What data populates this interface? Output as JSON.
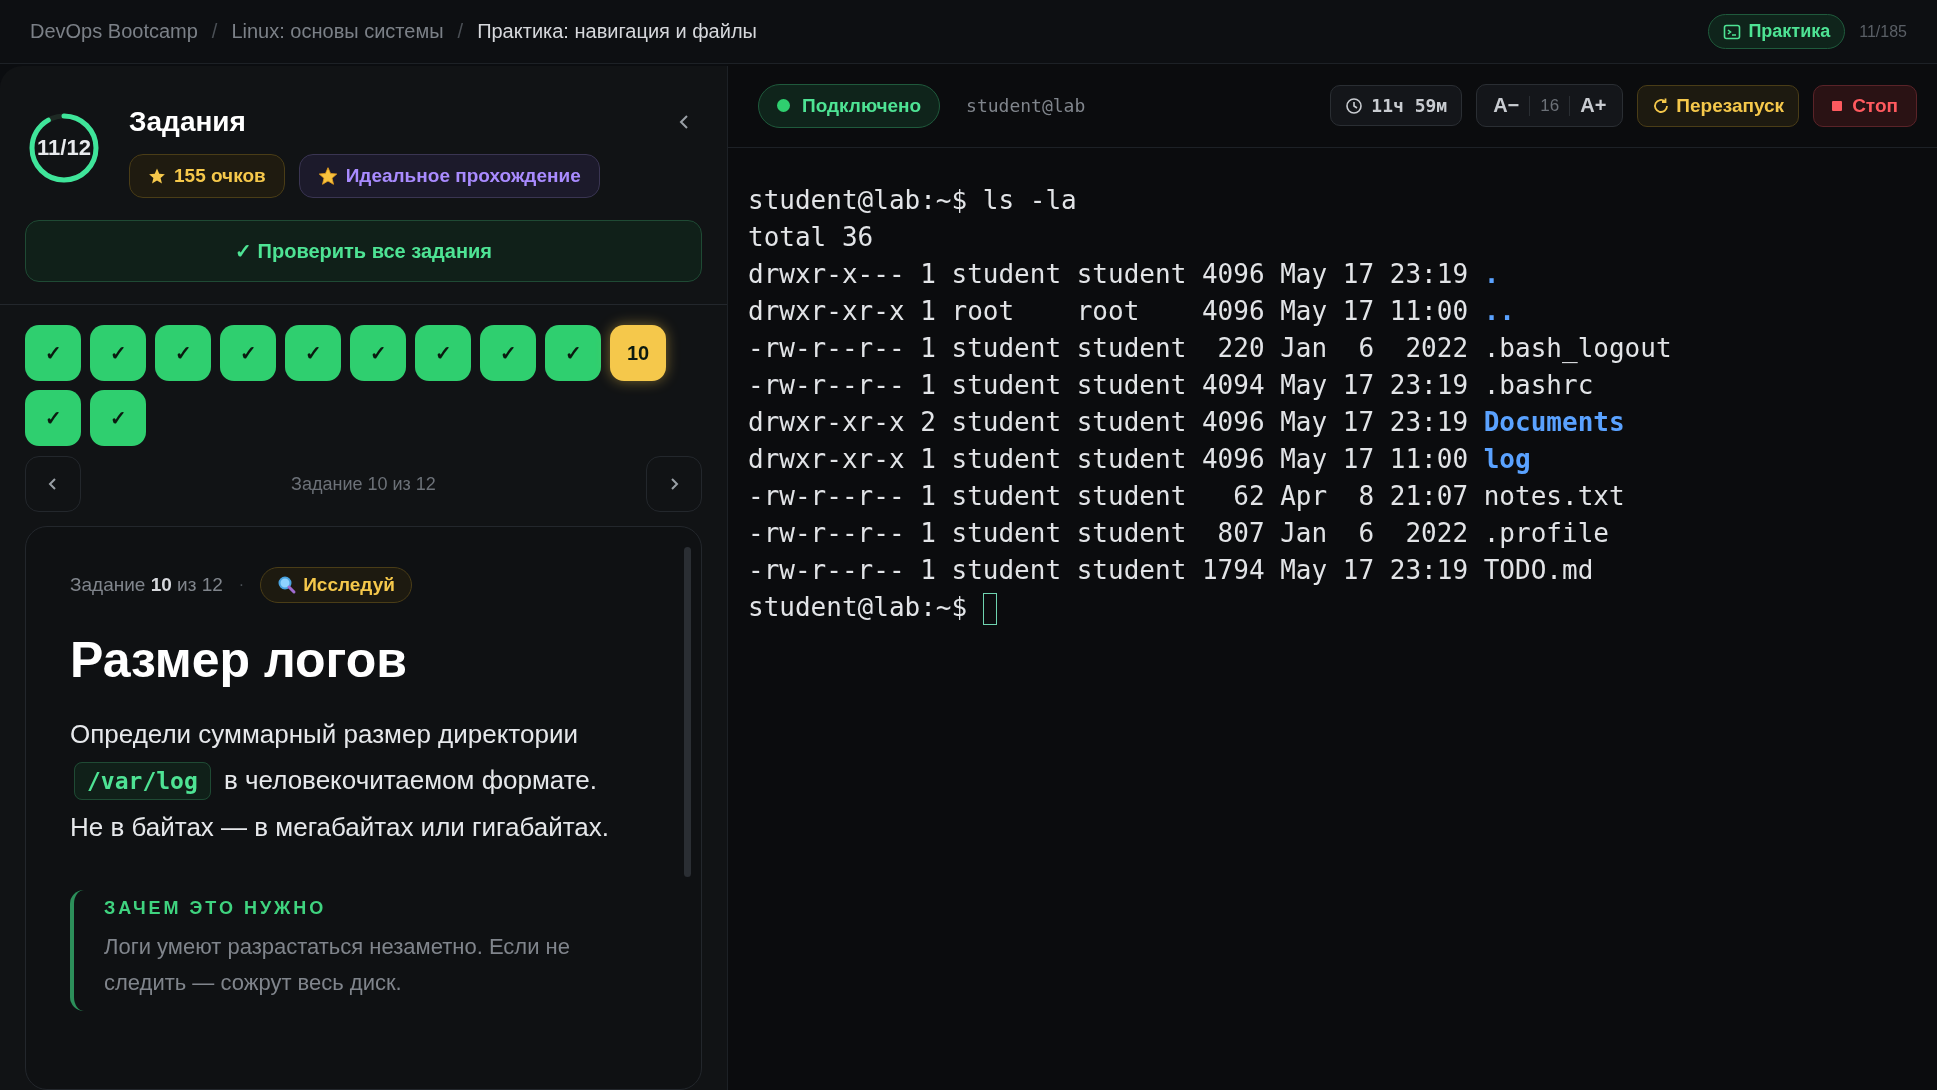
{
  "breadcrumbs": [
    {
      "label": "DevOps Bootcamp",
      "current": false
    },
    {
      "label": "Linux: основы системы",
      "current": false
    },
    {
      "label": "Практика: навигация и файлы",
      "current": true
    }
  ],
  "breadcrumb_separator": "/",
  "mode_badge": {
    "label": "Практика"
  },
  "counter": "11/185",
  "tasks_panel": {
    "title": "Задания",
    "progress": {
      "text": "11/12"
    },
    "badges": [
      {
        "kind": "points",
        "label": "155 очков"
      },
      {
        "kind": "achievement",
        "label": "Идеальное прохождение"
      }
    ],
    "check_all_button": "✓ Проверить все задания",
    "tiles": [
      {
        "label": "✓",
        "done": true,
        "selected": false
      },
      {
        "label": "✓",
        "done": true,
        "selected": false
      },
      {
        "label": "✓",
        "done": true,
        "selected": false
      },
      {
        "label": "✓",
        "done": true,
        "selected": false
      },
      {
        "label": "✓",
        "done": true,
        "selected": false
      },
      {
        "label": "✓",
        "done": true,
        "selected": false
      },
      {
        "label": "✓",
        "done": true,
        "selected": false
      },
      {
        "label": "✓",
        "done": true,
        "selected": false
      },
      {
        "label": "✓",
        "done": true,
        "selected": false
      },
      {
        "label": "10",
        "done": false,
        "selected": true
      },
      {
        "label": "✓",
        "done": true,
        "selected": false
      },
      {
        "label": "✓",
        "done": true,
        "selected": false
      }
    ],
    "nav_label": "Задание 10 из 12"
  },
  "task": {
    "meta": "Задание **10** из 12",
    "separator": "·",
    "tag": "Исследуй",
    "title": "Размер логов",
    "description": [
      {
        "kind": "text",
        "text": "Определи суммарный размер директории "
      },
      {
        "kind": "code",
        "text": "/var/log"
      },
      {
        "kind": "text",
        "text": " в человекочитаемом формате. Не в байтах — в мегабайтах или гигабайтах."
      }
    ],
    "why": {
      "heading": "ЗАЧЕМ ЭТО НУЖНО",
      "text": "Логи умеют разрастаться незаметно. Если не следить — сожрут весь диск."
    }
  },
  "terminal": {
    "status": {
      "label": "Подключено",
      "connected": true
    },
    "host": "student@lab",
    "timer": "11ч 59м",
    "font_decrease": "A−",
    "font_size": "16",
    "font_increase": "A+",
    "restart": "Перезапуск",
    "stop": "Стоп",
    "lines": [
      {
        "kind": "prompt",
        "prompt": "student@lab:~$",
        "command": "ls -la"
      },
      {
        "kind": "text",
        "text": "total 36"
      },
      {
        "kind": "entry",
        "meta": "drwxr-x--- 1 student student 4096 May 17 23:19",
        "name": ".",
        "dir": true
      },
      {
        "kind": "entry",
        "meta": "drwxr-xr-x 1 root    root    4096 May 17 11:00",
        "name": "..",
        "dir": true
      },
      {
        "kind": "entry",
        "meta": "-rw-r--r-- 1 student student  220 Jan  6  2022",
        "name": ".bash_logout",
        "dir": false
      },
      {
        "kind": "entry",
        "meta": "-rw-r--r-- 1 student student 4094 May 17 23:19",
        "name": ".bashrc",
        "dir": false
      },
      {
        "kind": "entry",
        "meta": "drwxr-xr-x 2 student student 4096 May 17 23:19",
        "name": "Documents",
        "dir": true
      },
      {
        "kind": "entry",
        "meta": "drwxr-xr-x 1 student student 4096 May 17 11:00",
        "name": "log",
        "dir": true
      },
      {
        "kind": "entry",
        "meta": "-rw-r--r-- 1 student student   62 Apr  8 21:07",
        "name": "notes.txt",
        "dir": false
      },
      {
        "kind": "entry",
        "meta": "-rw-r--r-- 1 student student  807 Jan  6  2022",
        "name": ".profile",
        "dir": false
      },
      {
        "kind": "entry",
        "meta": "-rw-r--r-- 1 student student 1794 May 17 23:19",
        "name": "TODO.md",
        "dir": false
      },
      {
        "kind": "prompt",
        "prompt": "student@lab:~$",
        "cursor": true
      }
    ]
  }
}
